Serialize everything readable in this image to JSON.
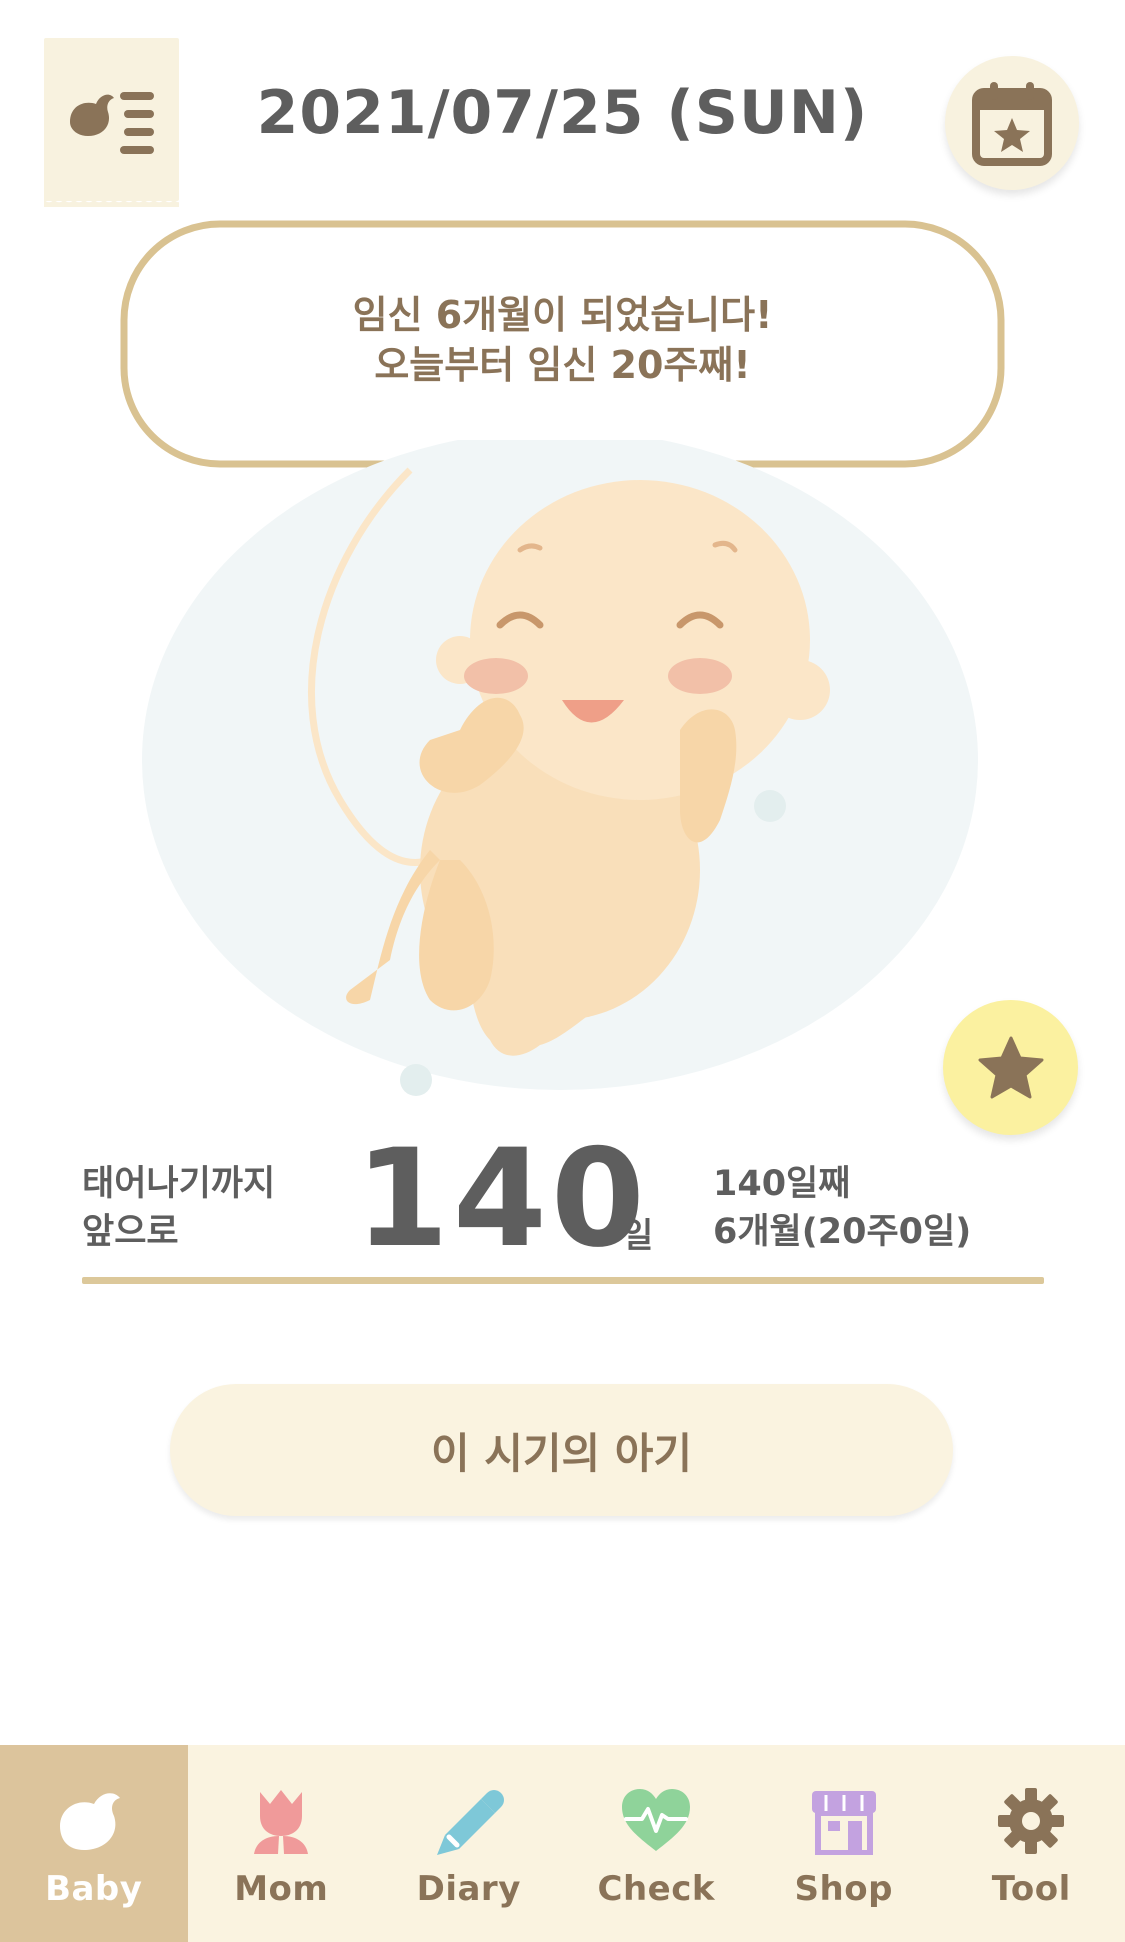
{
  "header": {
    "date_title": "2021/07/25 (SUN)",
    "menu_icon": "bird-list-icon",
    "calendar_icon": "calendar-star-icon"
  },
  "bubble": {
    "line1": "임신 6개월이 되었습니다!",
    "line2": "오늘부터 임신 20주째!"
  },
  "countdown": {
    "label_line1": "태어나기까지",
    "label_line2": "앞으로",
    "days_remaining": "140",
    "unit": "일",
    "info_line1": "140일째",
    "info_line2": "6개월(20주0일)"
  },
  "actions": {
    "baby_info_button": "이 시기의 아기",
    "favorite_icon": "star-icon"
  },
  "nav": {
    "items": [
      {
        "label": "Baby",
        "icon": "bird-icon",
        "color": "#ffffff",
        "active": true
      },
      {
        "label": "Mom",
        "icon": "tulip-icon",
        "color": "#f09a9a",
        "active": false
      },
      {
        "label": "Diary",
        "icon": "pencil-icon",
        "color": "#7ec8d8",
        "active": false
      },
      {
        "label": "Check",
        "icon": "heartbeat-icon",
        "color": "#8fd39a",
        "active": false
      },
      {
        "label": "Shop",
        "icon": "store-icon",
        "color": "#c3a2e0",
        "active": false
      },
      {
        "label": "Tool",
        "icon": "gear-icon",
        "color": "#8a7358",
        "active": false
      }
    ]
  },
  "colors": {
    "accent_tan": "#dcc49c",
    "cream": "#faf3e0",
    "text_brown": "#8a7358",
    "text_gray": "#5e5e5e",
    "star_yellow": "#fbf1a0"
  }
}
